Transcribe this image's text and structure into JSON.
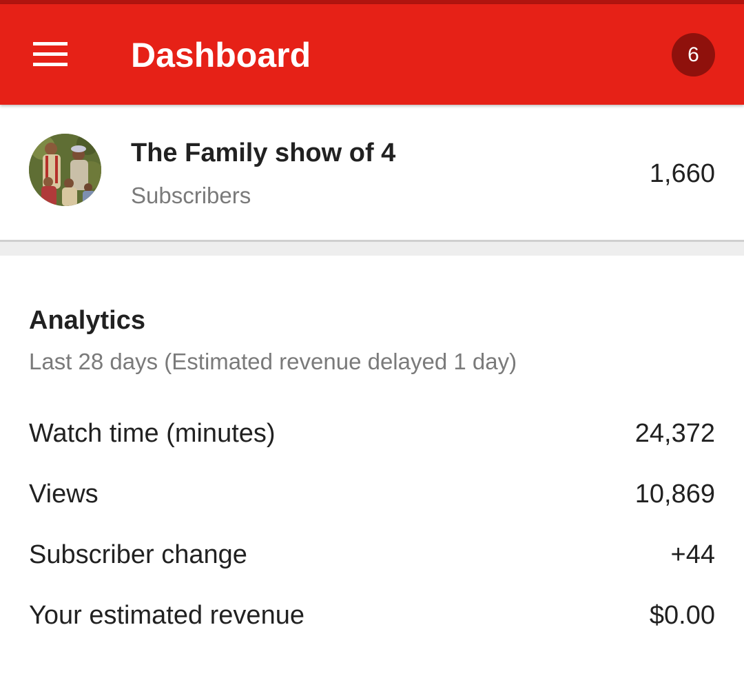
{
  "app_bar": {
    "title": "Dashboard",
    "menu_icon": "hamburger-menu-icon",
    "notification_count": "6",
    "color": "#e62117"
  },
  "channel": {
    "name": "The Family show of 4",
    "subscribers_label": "Subscribers",
    "subscribers_count": "1,660",
    "avatar": "family-portrait-avatar"
  },
  "analytics": {
    "title": "Analytics",
    "subtitle": "Last 28 days (Estimated revenue delayed 1 day)",
    "metrics": [
      {
        "label": "Watch time (minutes)",
        "value": "24,372"
      },
      {
        "label": "Views",
        "value": "10,869"
      },
      {
        "label": "Subscriber change",
        "value": "+44"
      },
      {
        "label": "Your estimated revenue",
        "value": "$0.00"
      }
    ]
  }
}
